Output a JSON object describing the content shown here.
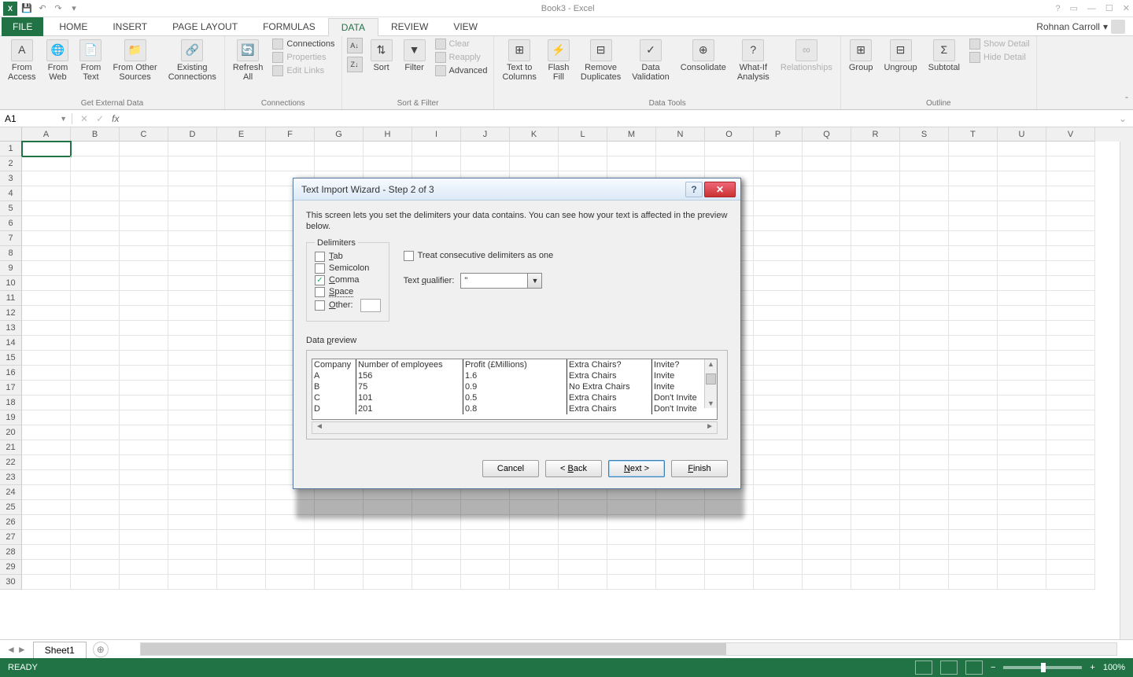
{
  "titlebar": {
    "title": "Book3 - Excel"
  },
  "user": {
    "name": "Rohnan Carroll"
  },
  "ribbon_tabs": {
    "file": "FILE",
    "home": "HOME",
    "insert": "INSERT",
    "page_layout": "PAGE LAYOUT",
    "formulas": "FORMULAS",
    "data": "DATA",
    "review": "REVIEW",
    "view": "VIEW"
  },
  "ribbon": {
    "get_external": {
      "label": "Get External Data",
      "from_access": "From\nAccess",
      "from_web": "From\nWeb",
      "from_text": "From\nText",
      "from_other": "From Other\nSources",
      "existing": "Existing\nConnections"
    },
    "connections": {
      "label": "Connections",
      "refresh": "Refresh\nAll",
      "conn": "Connections",
      "prop": "Properties",
      "edit": "Edit Links"
    },
    "sort_filter": {
      "label": "Sort & Filter",
      "sort": "Sort",
      "filter": "Filter",
      "clear": "Clear",
      "reapply": "Reapply",
      "advanced": "Advanced"
    },
    "data_tools": {
      "label": "Data Tools",
      "ttc": "Text to\nColumns",
      "flash": "Flash\nFill",
      "remove": "Remove\nDuplicates",
      "valid": "Data\nValidation",
      "consol": "Consolidate",
      "whatif": "What-If\nAnalysis",
      "rel": "Relationships"
    },
    "outline": {
      "label": "Outline",
      "group": "Group",
      "ungroup": "Ungroup",
      "subtotal": "Subtotal",
      "show": "Show Detail",
      "hide": "Hide Detail"
    }
  },
  "namebox": {
    "cell": "A1"
  },
  "columns": [
    "A",
    "B",
    "C",
    "D",
    "E",
    "F",
    "G",
    "H",
    "I",
    "J",
    "K",
    "L",
    "M",
    "N",
    "O",
    "P",
    "Q",
    "R",
    "S",
    "T",
    "U",
    "V"
  ],
  "rows": [
    "1",
    "2",
    "3",
    "4",
    "5",
    "6",
    "7",
    "8",
    "9",
    "10",
    "11",
    "12",
    "13",
    "14",
    "15",
    "16",
    "17",
    "18",
    "19",
    "20",
    "21",
    "22",
    "23",
    "24",
    "25",
    "26",
    "27",
    "28",
    "29",
    "30"
  ],
  "sheet": {
    "name": "Sheet1"
  },
  "status": {
    "ready": "READY",
    "zoom": "100%"
  },
  "dialog": {
    "title": "Text Import Wizard - Step 2 of 3",
    "desc": "This screen lets you set the delimiters your data contains.  You can see how your text is affected in the preview below.",
    "delimiters_label": "Delimiters",
    "tab": "Tab",
    "semicolon": "Semicolon",
    "comma": "Comma",
    "space": "Space",
    "other": "Other:",
    "consecutive": "Treat consecutive delimiters as one",
    "qualifier_label": "Text qualifier:",
    "qualifier_value": "\"",
    "preview_label": "Data preview",
    "preview_headers": [
      "Company",
      "Number of employees",
      "Profit (£Millions)",
      "Extra Chairs?",
      "Invite?"
    ],
    "preview_rows": [
      [
        "A",
        "156",
        "1.6",
        "Extra Chairs",
        "Invite"
      ],
      [
        "B",
        "75",
        "0.9",
        "No Extra Chairs",
        "Invite"
      ],
      [
        "C",
        "101",
        "0.5",
        "Extra Chairs",
        "Don't Invite"
      ],
      [
        "D",
        "201",
        "0.8",
        "Extra Chairs",
        "Don't Invite"
      ]
    ],
    "cancel": "Cancel",
    "back": "< Back",
    "next": "Next >",
    "finish": "Finish"
  }
}
